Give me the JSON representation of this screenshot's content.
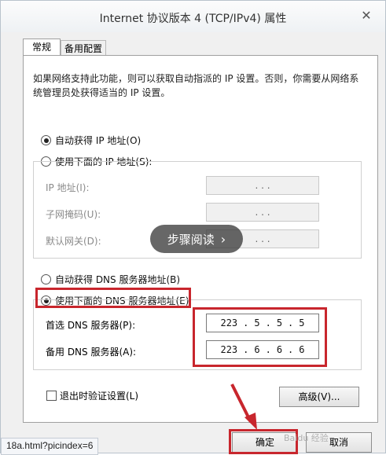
{
  "window": {
    "title": "Internet 协议版本 4 (TCP/IPv4) 属性",
    "close_glyph": "✕"
  },
  "tabs": [
    {
      "label": "常规"
    },
    {
      "label": "备用配置"
    }
  ],
  "description": "如果网络支持此功能，则可以获取自动指派的 IP 设置。否则，你需要从网络系统管理员处获得适当的 IP 设置。",
  "ip": {
    "auto_label": "自动获得 IP 地址(O)",
    "manual_label": "使用下面的 IP 地址(S):",
    "selected": "auto",
    "fields": [
      {
        "label": "IP 地址(I):",
        "value": ".   .   ."
      },
      {
        "label": "子网掩码(U):",
        "value": ".   .   ."
      },
      {
        "label": "默认网关(D):",
        "value": ".   .   ."
      }
    ]
  },
  "dns": {
    "auto_label": "自动获得 DNS 服务器地址(B)",
    "manual_label": "使用下面的 DNS 服务器地址(E):",
    "selected": "manual",
    "preferred_label": "首选 DNS 服务器(P):",
    "preferred_parts": [
      "223",
      ".",
      "5",
      ".",
      "5",
      ".",
      "5"
    ],
    "alternate_label": "备用 DNS 服务器(A):",
    "alternate_parts": [
      "223",
      ".",
      "6",
      ".",
      "6",
      ".",
      "6"
    ]
  },
  "validate_label": "退出时验证设置(L)",
  "advanced_button": "高级(V)...",
  "ok_button": "确定",
  "cancel_button": "取消",
  "overlay_text": "步骤阅读",
  "overlay_glyph": "›",
  "url_text": "18a.html?picindex=6",
  "watermark_text": "Baidu 经验",
  "highlight_color": "#c8262d"
}
